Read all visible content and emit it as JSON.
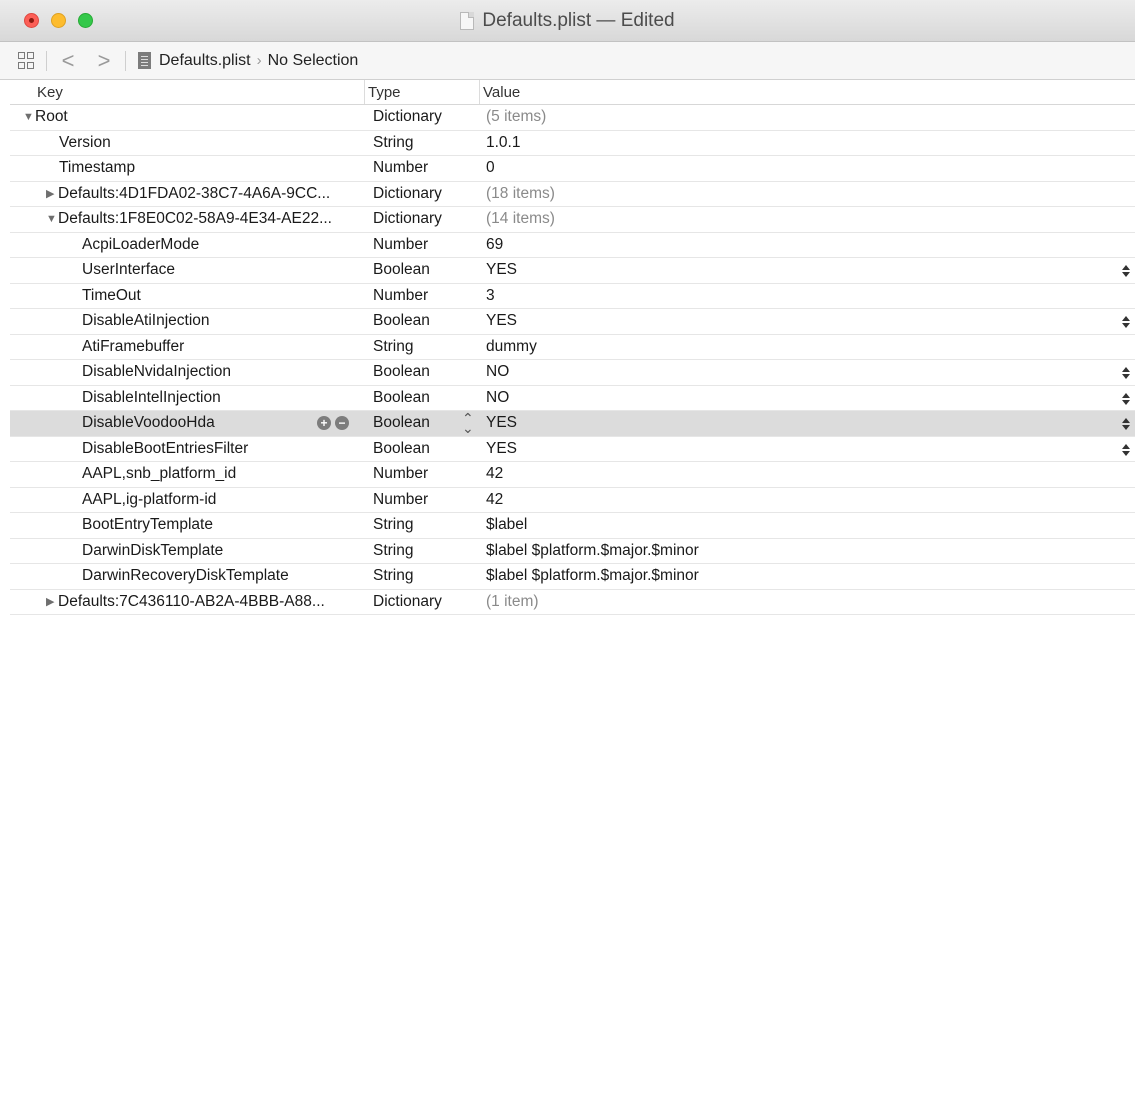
{
  "window": {
    "title": "Defaults.plist — Edited"
  },
  "navbar": {
    "back_glyph": "<",
    "forward_glyph": ">",
    "crumb_file": "Defaults.plist",
    "crumb_separator": "›",
    "crumb_selection": "No Selection"
  },
  "columns": {
    "key": "Key",
    "type": "Type",
    "value": "Value"
  },
  "rows": [
    {
      "key": "Root",
      "type": "Dictionary",
      "value": "(5 items)",
      "disclosure": "expanded"
    },
    {
      "key": "Version",
      "type": "String",
      "value": "1.0.1"
    },
    {
      "key": "Timestamp",
      "type": "Number",
      "value": "0"
    },
    {
      "key": "Defaults:4D1FDA02-38C7-4A6A-9CC...",
      "type": "Dictionary",
      "value": "(18 items)",
      "disclosure": "collapsed"
    },
    {
      "key": "Defaults:1F8E0C02-58A9-4E34-AE22...",
      "type": "Dictionary",
      "value": "(14 items)",
      "disclosure": "expanded"
    },
    {
      "key": "AcpiLoaderMode",
      "type": "Number",
      "value": "69"
    },
    {
      "key": "UserInterface",
      "type": "Boolean",
      "value": "YES"
    },
    {
      "key": "TimeOut",
      "type": "Number",
      "value": "3"
    },
    {
      "key": "DisableAtiInjection",
      "type": "Boolean",
      "value": "YES"
    },
    {
      "key": "AtiFramebuffer",
      "type": "String",
      "value": "dummy"
    },
    {
      "key": "DisableNvidaInjection",
      "type": "Boolean",
      "value": "NO"
    },
    {
      "key": "DisableIntelInjection",
      "type": "Boolean",
      "value": "NO"
    },
    {
      "key": "DisableVoodooHda",
      "type": "Boolean",
      "value": "YES",
      "selected": true
    },
    {
      "key": "DisableBootEntriesFilter",
      "type": "Boolean",
      "value": "YES"
    },
    {
      "key": "AAPL,snb_platform_id",
      "type": "Number",
      "value": "42"
    },
    {
      "key": "AAPL,ig-platform-id",
      "type": "Number",
      "value": "42"
    },
    {
      "key": "BootEntryTemplate",
      "type": "String",
      "value": "$label"
    },
    {
      "key": "DarwinDiskTemplate",
      "type": "String",
      "value": "$label $platform.$major.$minor"
    },
    {
      "key": "DarwinRecoveryDiskTemplate",
      "type": "String",
      "value": "$label $platform.$major.$minor"
    },
    {
      "key": "Defaults:7C436110-AB2A-4BBB-A88...",
      "type": "Dictionary",
      "value": "(1 item)",
      "disclosure": "collapsed"
    }
  ]
}
